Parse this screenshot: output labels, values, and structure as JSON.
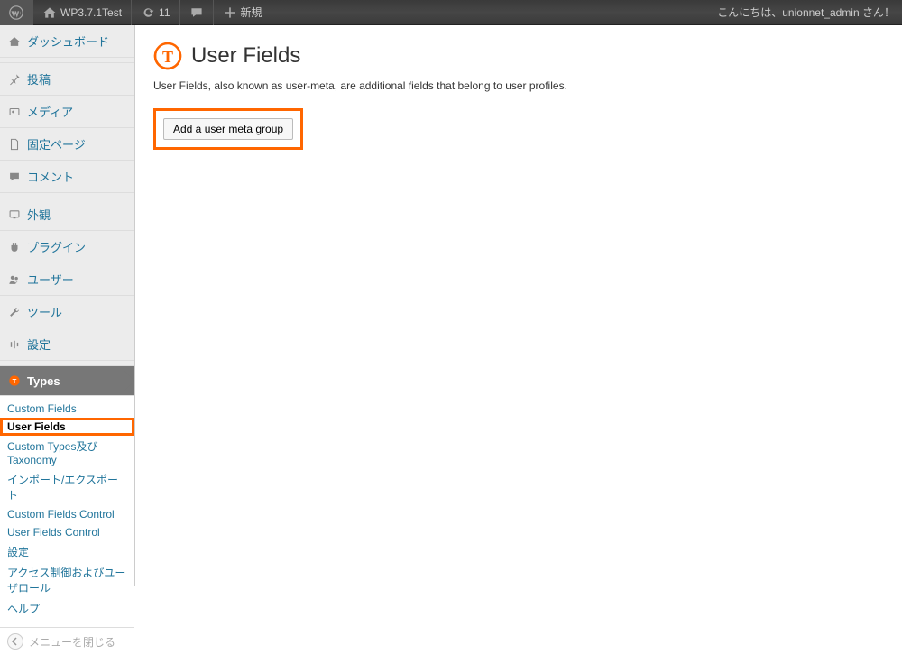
{
  "toolbar": {
    "site_title": "WP3.7.1Test",
    "updates_count": "11",
    "new_label": "新規",
    "greeting": "こんにちは、unionnet_admin さん！"
  },
  "sidebar": {
    "items": [
      {
        "label": "ダッシュボード"
      },
      {
        "label": "投稿"
      },
      {
        "label": "メディア"
      },
      {
        "label": "固定ページ"
      },
      {
        "label": "コメント"
      },
      {
        "label": "外観"
      },
      {
        "label": "プラグイン"
      },
      {
        "label": "ユーザー"
      },
      {
        "label": "ツール"
      },
      {
        "label": "設定"
      },
      {
        "label": "Types"
      }
    ],
    "types_sub": [
      {
        "label": "Custom Fields"
      },
      {
        "label": "User Fields"
      },
      {
        "label": "Custom Types及びTaxonomy"
      },
      {
        "label": "インポート/エクスポート"
      },
      {
        "label": "Custom Fields Control"
      },
      {
        "label": "User Fields Control"
      },
      {
        "label": "設定"
      },
      {
        "label": "アクセス制御およびユーザロール"
      },
      {
        "label": "ヘルプ"
      }
    ],
    "collapse_label": "メニューを閉じる"
  },
  "page": {
    "heading": "User Fields",
    "description": "User Fields, also known as user-meta, are additional fields that belong to user profiles.",
    "add_button": "Add a user meta group"
  },
  "colors": {
    "highlight": "#f60",
    "link": "#21759b"
  }
}
